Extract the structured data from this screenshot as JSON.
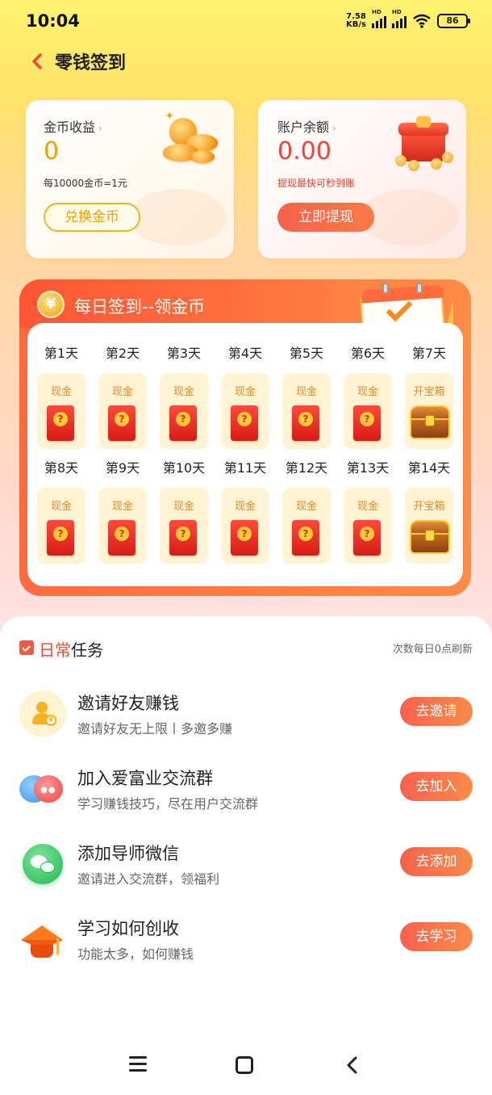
{
  "status_bar": {
    "time": "10:04",
    "net_speed": "7.58",
    "net_unit": "KB/s",
    "hd1": "HD",
    "hd2": "HD",
    "battery": "86"
  },
  "header": {
    "title": "零钱签到"
  },
  "coin_card": {
    "label": "金币收益",
    "value": "0",
    "rate": "每10000金币=1元",
    "button": "兑换金币"
  },
  "balance_card": {
    "label": "账户余额",
    "value": "0.00",
    "note": "提现最快可秒到账",
    "button": "立即提现"
  },
  "signin": {
    "yuan_symbol": "¥",
    "title": "每日签到--领金币",
    "rows": [
      {
        "days": [
          {
            "day": "第1天",
            "reward": "现金",
            "kind": "envelope"
          },
          {
            "day": "第2天",
            "reward": "现金",
            "kind": "envelope"
          },
          {
            "day": "第3天",
            "reward": "现金",
            "kind": "envelope"
          },
          {
            "day": "第4天",
            "reward": "现金",
            "kind": "envelope"
          },
          {
            "day": "第5天",
            "reward": "现金",
            "kind": "envelope"
          },
          {
            "day": "第6天",
            "reward": "现金",
            "kind": "envelope"
          },
          {
            "day": "第7天",
            "reward": "开宝箱",
            "kind": "chest"
          }
        ]
      },
      {
        "days": [
          {
            "day": "第8天",
            "reward": "现金",
            "kind": "envelope"
          },
          {
            "day": "第9天",
            "reward": "现金",
            "kind": "envelope"
          },
          {
            "day": "第10天",
            "reward": "现金",
            "kind": "envelope"
          },
          {
            "day": "第11天",
            "reward": "现金",
            "kind": "envelope"
          },
          {
            "day": "第12天",
            "reward": "现金",
            "kind": "envelope"
          },
          {
            "day": "第13天",
            "reward": "现金",
            "kind": "envelope"
          },
          {
            "day": "第14天",
            "reward": "开宝箱",
            "kind": "chest"
          }
        ]
      }
    ]
  },
  "tasks": {
    "title_highlight": "日常",
    "title_rest": "任务",
    "note": "次数每日0点刷新",
    "items": [
      {
        "name": "邀请好友赚钱",
        "desc": "邀请好友无上限丨多邀多赚",
        "button": "去邀请",
        "icon": "invite-friend-icon"
      },
      {
        "name": "加入爱富业交流群",
        "desc": "学习赚钱技巧，尽在用户交流群",
        "button": "去加入",
        "icon": "chat-group-icon"
      },
      {
        "name": "添加导师微信",
        "desc": "邀请进入交流群，领福利",
        "button": "去添加",
        "icon": "wechat-icon"
      },
      {
        "name": "学习如何创收",
        "desc": "功能太多，如何赚钱",
        "button": "去学习",
        "icon": "graduation-cap-icon"
      }
    ]
  },
  "colors": {
    "accent_red": "#ef4434",
    "accent_gold": "#f2a200",
    "button_orange": "#f8614c"
  }
}
